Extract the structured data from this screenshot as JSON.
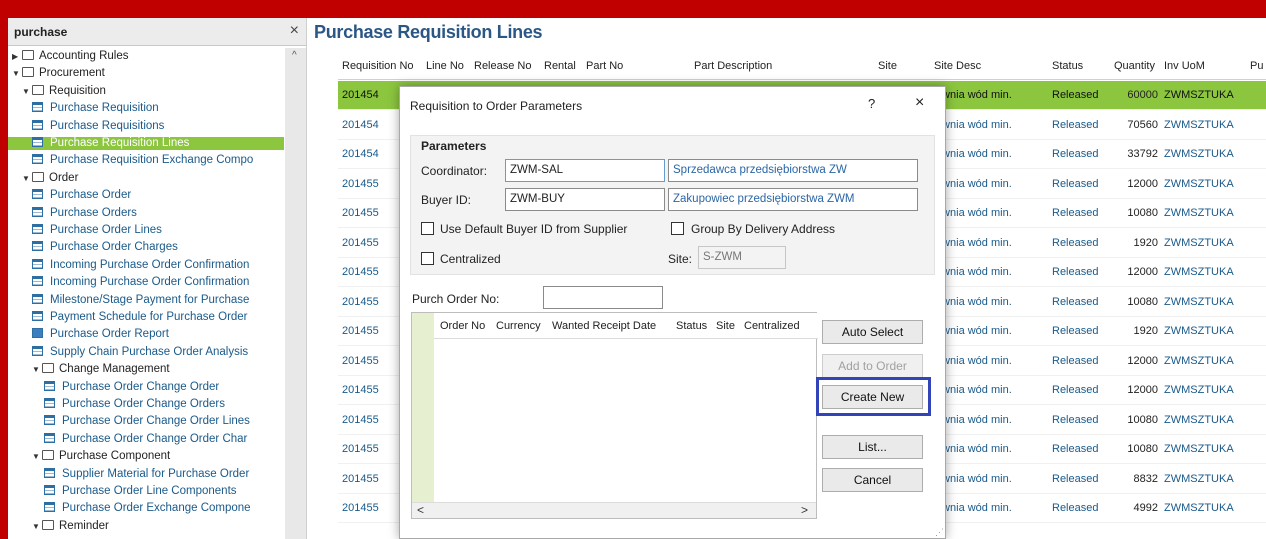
{
  "navigator": {
    "search_text": "purchase",
    "close_glyph": "×",
    "scroll_up_glyph": "^",
    "tree": [
      {
        "label": "Accounting Rules",
        "kind": "folder",
        "level": 0,
        "expander": "▶"
      },
      {
        "label": "Procurement",
        "kind": "folder",
        "level": 0,
        "expander": "▼"
      },
      {
        "label": "Requisition",
        "kind": "folder",
        "level": 1,
        "expander": "▼"
      },
      {
        "label": "Purchase Requisition",
        "kind": "leaf",
        "level": 2
      },
      {
        "label": "Purchase Requisitions",
        "kind": "leaf",
        "level": 2
      },
      {
        "label": "Purchase Requisition Lines",
        "kind": "leaf",
        "level": 2,
        "selected": true
      },
      {
        "label": "Purchase Requisition Exchange Compo",
        "kind": "leaf",
        "level": 2
      },
      {
        "label": "Order",
        "kind": "folder",
        "level": 1,
        "expander": "▼"
      },
      {
        "label": "Purchase Order",
        "kind": "leaf",
        "level": 2
      },
      {
        "label": "Purchase Orders",
        "kind": "leaf",
        "level": 2
      },
      {
        "label": "Purchase Order Lines",
        "kind": "leaf",
        "level": 2
      },
      {
        "label": "Purchase Order Charges",
        "kind": "leaf",
        "level": 2
      },
      {
        "label": "Incoming Purchase Order Confirmation",
        "kind": "leaf",
        "level": 2
      },
      {
        "label": "Incoming Purchase Order Confirmation",
        "kind": "leaf",
        "level": 2
      },
      {
        "label": "Milestone/Stage Payment for Purchase",
        "kind": "leaf",
        "level": 2
      },
      {
        "label": "Payment Schedule for Purchase Order",
        "kind": "leaf",
        "level": 2
      },
      {
        "label": "Purchase Order Report",
        "kind": "leaf",
        "level": 2,
        "chart": true
      },
      {
        "label": "Supply Chain Purchase Order Analysis",
        "kind": "leaf",
        "level": 2
      },
      {
        "label": "Change Management",
        "kind": "folder",
        "level": 2,
        "expander": "▼"
      },
      {
        "label": "Purchase Order Change Order",
        "kind": "leaf",
        "level": 3
      },
      {
        "label": "Purchase Order Change Orders",
        "kind": "leaf",
        "level": 3
      },
      {
        "label": "Purchase Order Change Order Lines",
        "kind": "leaf",
        "level": 3
      },
      {
        "label": "Purchase Order Change Order Char",
        "kind": "leaf",
        "level": 3
      },
      {
        "label": "Purchase Component",
        "kind": "folder",
        "level": 2,
        "expander": "▼"
      },
      {
        "label": "Supplier Material for Purchase Order",
        "kind": "leaf",
        "level": 3
      },
      {
        "label": "Purchase Order Line Components",
        "kind": "leaf",
        "level": 3
      },
      {
        "label": "Purchase Order Exchange Compone",
        "kind": "leaf",
        "level": 3
      },
      {
        "label": "Reminder",
        "kind": "folder",
        "level": 2,
        "expander": "▼"
      }
    ]
  },
  "main": {
    "title": "Purchase Requisition Lines",
    "columns": [
      "Requisition No",
      "Line No",
      "Release No",
      "Rental",
      "Part No",
      "Part Description",
      "Site",
      "Site Desc",
      "Status",
      "Quantity",
      "Inv UoM",
      "Pu"
    ],
    "rows": [
      {
        "req": "201454",
        "site_desc": "zlewnia wód min.",
        "status": "Released",
        "qty": "60000",
        "uom": "ZWMSZTUKA",
        "selected": true
      },
      {
        "req": "201454",
        "site_desc": "zlewnia wód min.",
        "status": "Released",
        "qty": "70560",
        "uom": "ZWMSZTUKA"
      },
      {
        "req": "201454",
        "site_desc": "zlewnia wód min.",
        "status": "Released",
        "qty": "33792",
        "uom": "ZWMSZTUKA"
      },
      {
        "req": "201455",
        "site_desc": "zlewnia wód min.",
        "status": "Released",
        "qty": "12000",
        "uom": "ZWMSZTUKA"
      },
      {
        "req": "201455",
        "site_desc": "zlewnia wód min.",
        "status": "Released",
        "qty": "10080",
        "uom": "ZWMSZTUKA"
      },
      {
        "req": "201455",
        "site_desc": "zlewnia wód min.",
        "status": "Released",
        "qty": "1920",
        "uom": "ZWMSZTUKA"
      },
      {
        "req": "201455",
        "site_desc": "zlewnia wód min.",
        "status": "Released",
        "qty": "12000",
        "uom": "ZWMSZTUKA"
      },
      {
        "req": "201455",
        "site_desc": "zlewnia wód min.",
        "status": "Released",
        "qty": "10080",
        "uom": "ZWMSZTUKA"
      },
      {
        "req": "201455",
        "site_desc": "zlewnia wód min.",
        "status": "Released",
        "qty": "1920",
        "uom": "ZWMSZTUKA"
      },
      {
        "req": "201455",
        "site_desc": "zlewnia wód min.",
        "status": "Released",
        "qty": "12000",
        "uom": "ZWMSZTUKA"
      },
      {
        "req": "201455",
        "site_desc": "zlewnia wód min.",
        "status": "Released",
        "qty": "12000",
        "uom": "ZWMSZTUKA"
      },
      {
        "req": "201455",
        "site_desc": "zlewnia wód min.",
        "status": "Released",
        "qty": "10080",
        "uom": "ZWMSZTUKA"
      },
      {
        "req": "201455",
        "site_desc": "zlewnia wód min.",
        "status": "Released",
        "qty": "10080",
        "uom": "ZWMSZTUKA"
      },
      {
        "req": "201455",
        "site_desc": "zlewnia wód min.",
        "status": "Released",
        "qty": "8832",
        "uom": "ZWMSZTUKA"
      },
      {
        "req": "201455",
        "site_desc": "zlewnia wód min.",
        "status": "Released",
        "qty": "4992",
        "uom": "ZWMSZTUKA"
      }
    ]
  },
  "dialog": {
    "title": "Requisition to Order Parameters",
    "help_glyph": "?",
    "close_glyph": "×",
    "group_title": "Parameters",
    "coordinator_label": "Coordinator:",
    "coordinator_value": "ZWM-SAL",
    "coordinator_desc": "Sprzedawca przedsiębiorstwa ZW",
    "buyer_label": "Buyer ID:",
    "buyer_value": "ZWM-BUY",
    "buyer_desc": "Zakupowiec przedsiębiorstwa ZWM",
    "use_default_label": "Use Default Buyer ID from Supplier",
    "group_by_label": "Group By Delivery Address",
    "centralized_label": "Centralized",
    "site_label": "Site:",
    "site_value": "S-ZWM",
    "purch_order_label": "Purch Order No:",
    "purch_order_value": "",
    "list_columns": [
      "Order No",
      "Currency",
      "Wanted Receipt Date",
      "Status",
      "Site",
      "Centralized"
    ],
    "scroll_left_glyph": "<",
    "scroll_right_glyph": ">",
    "buttons": {
      "auto_select": "Auto Select",
      "add_to_order": "Add to Order",
      "create_new": "Create New",
      "list": "List...",
      "cancel": "Cancel"
    }
  },
  "colors": {
    "frame_red": "#c00000",
    "title_blue": "#2b5786",
    "selection_green": "#8cc63f",
    "highlight_blue": "#3344b8"
  }
}
